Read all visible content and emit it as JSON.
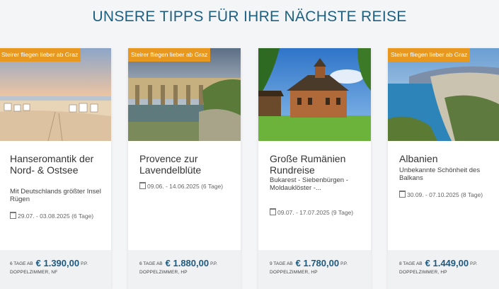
{
  "section": {
    "title": "UNSERE TIPPS FÜR IHRE NÄCHSTE REISE"
  },
  "colors": {
    "accent": "#e8981e",
    "title": "#1f5f7f",
    "price": "#1e5a80"
  },
  "cards": [
    {
      "badge": "Steirer fliegen lieber ab Graz",
      "title": "Hanseromantik der Nord- & Ostsee",
      "subtitle": "Mit Deutschlands größter Insel Rügen",
      "date": "29.07. - 03.08.2025 (6 Tage)",
      "price_prefix": "6 TAGE AB",
      "price": "€ 1.390,00",
      "price_suffix": "P.P.",
      "room": "DOPPELZIMMER, NF"
    },
    {
      "badge": "Steirer fliegen lieber ab Graz",
      "title": "Provence zur Lavendelblüte",
      "subtitle": "",
      "date": "09.06. - 14.06.2025 (6 Tage)",
      "price_prefix": "6 TAGE AB",
      "price": "€ 1.880,00",
      "price_suffix": "P.P.",
      "room": "DOPPELZIMMER, HP"
    },
    {
      "badge": "",
      "title": "Große Rumänien Rundreise",
      "subtitle": "Bukarest - Siebenbürgen - Moldauklöster -...",
      "date": "09.07. - 17.07.2025 (9 Tage)",
      "price_prefix": "9 TAGE AB",
      "price": "€ 1.780,00",
      "price_suffix": "P.P.",
      "room": "DOPPELZIMMER, HP"
    },
    {
      "badge": "Steirer fliegen lieber ab Graz",
      "title": "Albanien",
      "subtitle": "Unbekannte Schönheit des Balkans",
      "date": "30.09. - 07.10.2025 (8 Tage)",
      "price_prefix": "8 TAGE AB",
      "price": "€ 1.449,00",
      "price_suffix": "P.P.",
      "room": "DOPPELZIMMER, HP"
    }
  ]
}
